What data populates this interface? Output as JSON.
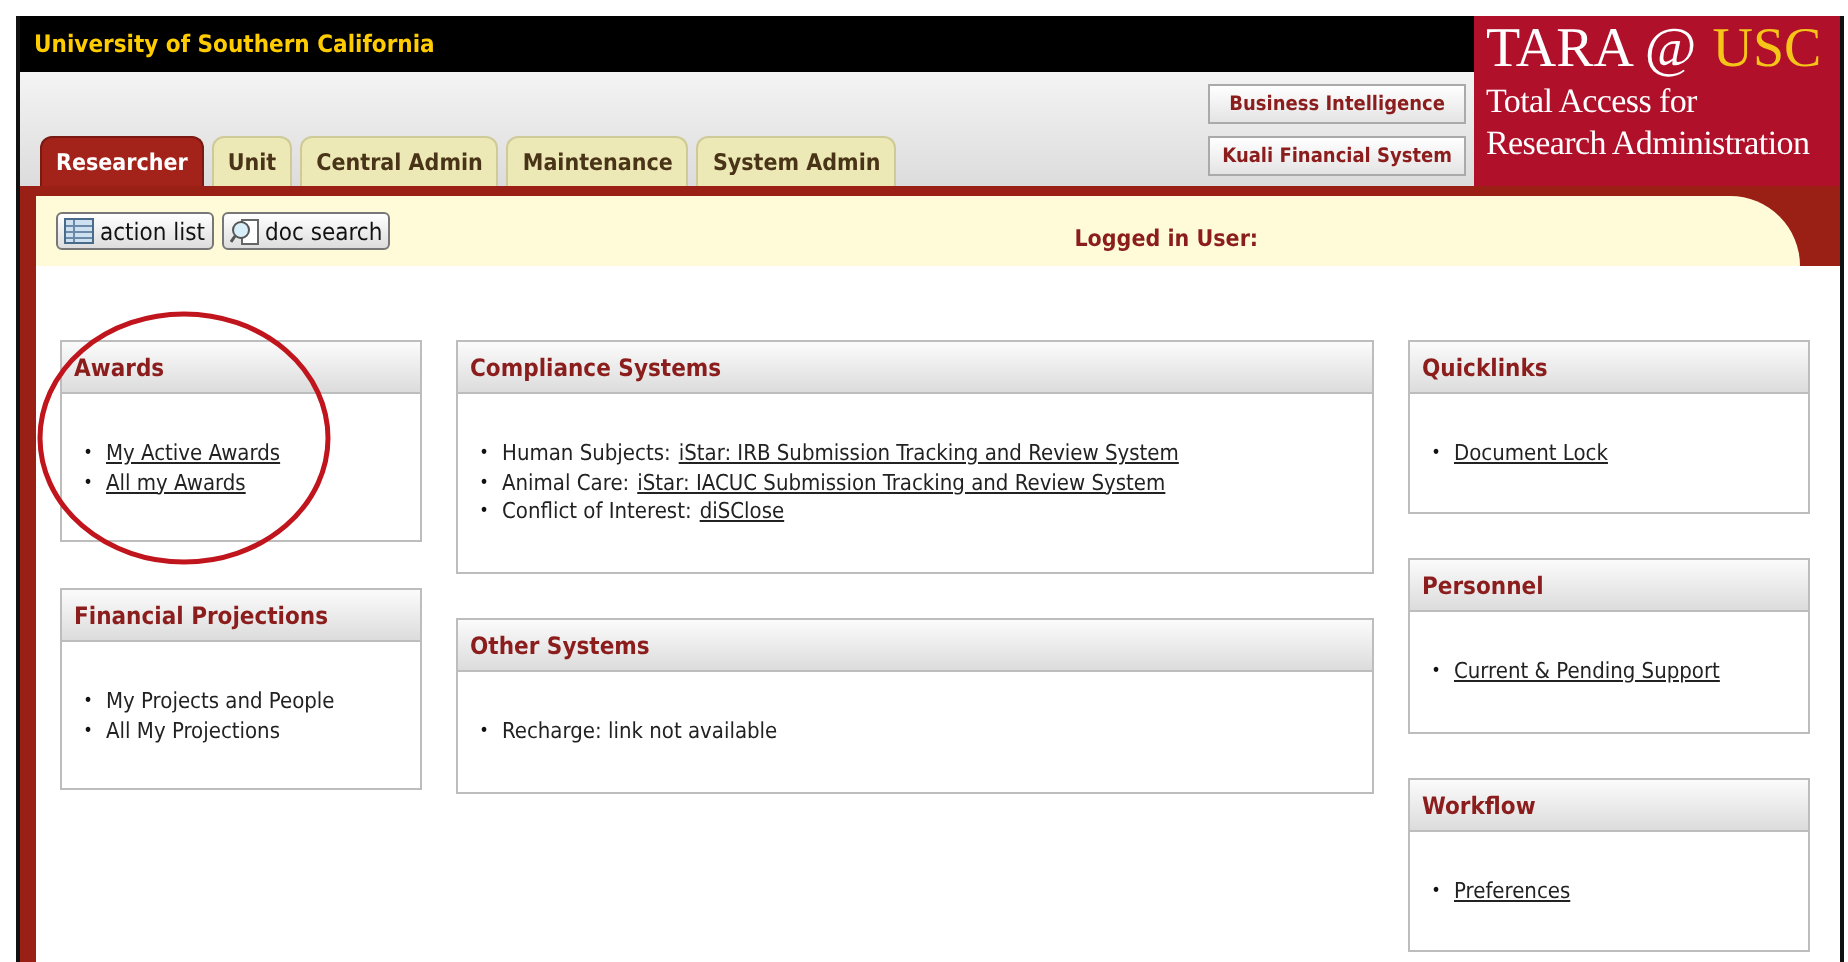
{
  "header": {
    "title": "University of Southern California"
  },
  "logo": {
    "title": "TARA @",
    "highlight": "USC",
    "lines": [
      "Total Access for",
      "Research Administration"
    ]
  },
  "tabs": [
    {
      "label": "Researcher",
      "selected": true
    },
    {
      "label": "Unit",
      "selected": false
    },
    {
      "label": "Central Admin",
      "selected": false
    },
    {
      "label": "Maintenance",
      "selected": false
    },
    {
      "label": "System Admin",
      "selected": false
    }
  ],
  "system_links": [
    "Business Intelligence",
    "Kuali Financial System"
  ],
  "toolbar": {
    "buttons": [
      {
        "label": "action list",
        "kind": "list"
      },
      {
        "label": "doc search",
        "kind": "search"
      }
    ],
    "user_label": "Logged in User:"
  },
  "columns": [
    {
      "panels": [
        {
          "title": "Awards",
          "circled": true,
          "items": [
            {
              "kind": "link",
              "bullet": "•",
              "link": "My Active Awards"
            },
            {
              "kind": "link",
              "bullet": "•",
              "link": "All my Awards"
            }
          ]
        },
        {
          "title": "Financial Projections",
          "circled": false,
          "items": [
            {
              "kind": "text",
              "bullet": "•",
              "text": "My Projects and People"
            },
            {
              "kind": "text",
              "bullet": "•",
              "text": "All My Projections"
            }
          ]
        }
      ]
    },
    {
      "panels": [
        {
          "title": "Compliance Systems",
          "circled": false,
          "items": [
            {
              "kind": "labeled",
              "bullet": "•",
              "text": "Human Subjects:",
              "link": "iStar: IRB Submission Tracking and Review System"
            },
            {
              "kind": "labeled",
              "bullet": "•",
              "text": "Animal Care:",
              "link": "iStar: IACUC Submission Tracking and Review System"
            },
            {
              "kind": "labeled",
              "bullet": "•",
              "text": "Conflict of Interest:",
              "link": "diSClose"
            }
          ]
        },
        {
          "title": "Other Systems",
          "circled": false,
          "items": [
            {
              "kind": "text",
              "bullet": "•",
              "text": "Recharge: link not available"
            }
          ]
        }
      ]
    },
    {
      "panels": [
        {
          "title": "Quicklinks",
          "circled": false,
          "items": [
            {
              "kind": "link",
              "bullet": "•",
              "link": "Document Lock"
            }
          ]
        },
        {
          "title": "Personnel",
          "circled": false,
          "items": [
            {
              "kind": "link",
              "bullet": "•",
              "link": "Current & Pending Support"
            }
          ]
        },
        {
          "title": "Workflow",
          "circled": false,
          "items": [
            {
              "kind": "link",
              "bullet": "•",
              "link": "Preferences"
            }
          ]
        }
      ]
    }
  ]
}
